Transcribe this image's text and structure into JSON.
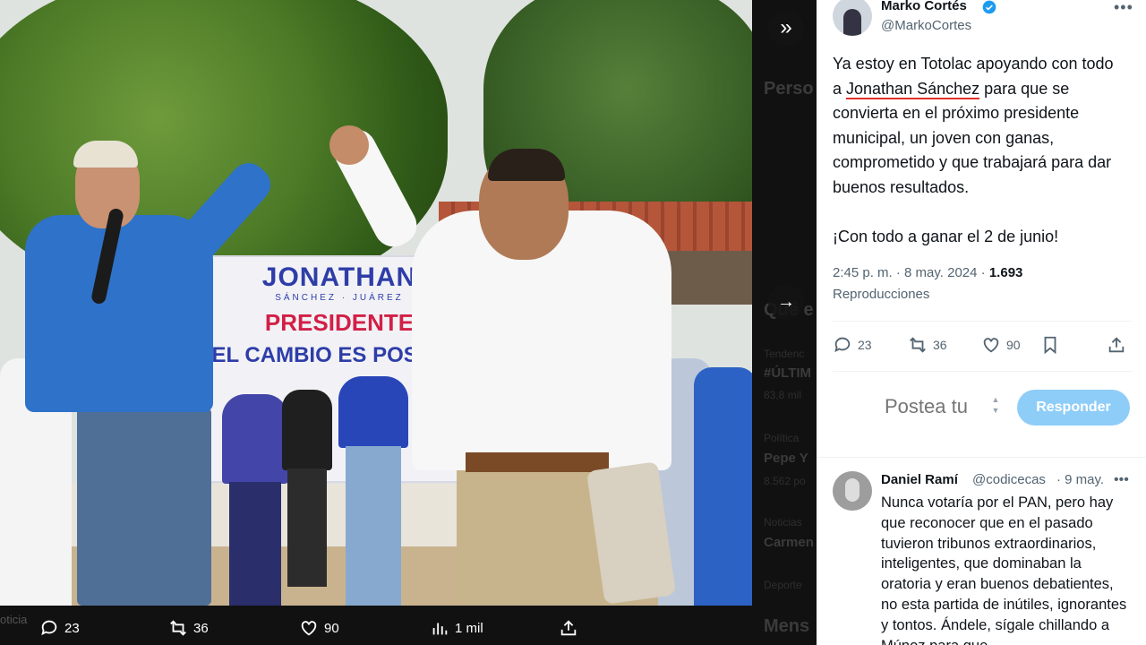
{
  "media": {
    "banner_name": "JONATHAN",
    "banner_sub": "SÁNCHEZ · JUÁREZ",
    "banner_role": "PRESIDENTE",
    "banner_slogan": "EL CAMBIO ES POSIBLE",
    "actions": {
      "replies": "23",
      "reposts": "36",
      "likes": "90",
      "views": "1 mil"
    }
  },
  "behind_page": {
    "persons": "Perso",
    "whats": "Qué e",
    "trend_label": "Tendenc",
    "trend_title": "#ÚLTIM",
    "trend_count": "83,8 mil",
    "politics_label": "Política",
    "politics_title": "Pepe Y",
    "politics_count": "8.562 po",
    "news_label": "Noticias",
    "news_title": "Carmen",
    "sports_label": "Deporte",
    "messages": "Mens",
    "left_bottom": "oticia"
  },
  "tweet": {
    "author_name": "Marko Cortés",
    "author_handle": "@MarkoCortes",
    "text_before": "Ya estoy en Totolac apoyando con todo a ",
    "text_link": "Jonathan Sánchez",
    "text_after": " para que se convierta en el próximo presidente municipal, un joven con ganas, comprometido y que trabajará para dar buenos resultados.\n\n¡Con todo a ganar el 2 de junio!",
    "time": "2:45 p. m.",
    "date": "8 may. 2024",
    "views": "1.693",
    "views_label": "Reproducciones",
    "replies": "23",
    "reposts": "36",
    "likes": "90"
  },
  "reply_box": {
    "placeholder": "Postea tu",
    "button": "Responder"
  },
  "reply": {
    "name": "Daniel Ramí",
    "handle": "@codicecas",
    "date": "· 9 may.",
    "text": "Nunca votaría por el PAN, pero hay que reconocer que en el pasado tuvieron tribunos extraordinarios, inteligentes, que dominaban la oratoria y eran buenos debatientes, no esta partida de inútiles, ignorantes y tontos. Ándele, sígale chillando a Múnoz para que"
  },
  "colors": {
    "accent": "#1d9bf0",
    "reply_button": "#8ecdf8",
    "link_underline": "#e0322b",
    "muted": "#536471"
  }
}
